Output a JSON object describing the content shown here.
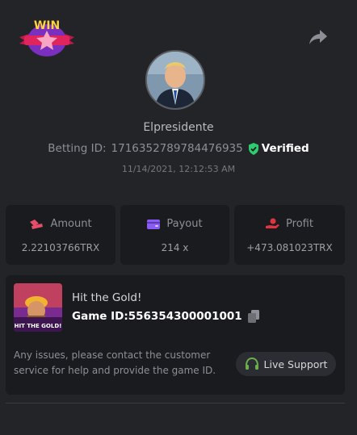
{
  "brand": {
    "badge_text": "WIN"
  },
  "profile": {
    "username": "Elpresidente",
    "betting_id_label": "Betting ID:",
    "betting_id": "1716352789784476935",
    "verified_label": "Verified",
    "timestamp": "11/14/2021, 12:12:53 AM"
  },
  "stats": {
    "amount": {
      "label": "Amount",
      "value": "2.22103766TRX"
    },
    "payout": {
      "label": "Payout",
      "value": "214 x"
    },
    "profit": {
      "label": "Profit",
      "value": "+473.081023TRX"
    }
  },
  "game": {
    "title": "Hit the Gold!",
    "id_label": "Game ID:",
    "id": "556354300001001",
    "thumb_text": "HIT THE GOLD!",
    "notice": "Any issues, please contact the customer service for help and provide the game ID.",
    "support_label": "Live Support"
  },
  "colors": {
    "background": "#232428",
    "card": "#1a1b1f",
    "verified_green": "#2ecc71",
    "amount_icon": "#e84d6a",
    "payout_icon": "#8a5cf6",
    "profit_icon": "#e0353f",
    "support_icon": "#6ab04c"
  }
}
